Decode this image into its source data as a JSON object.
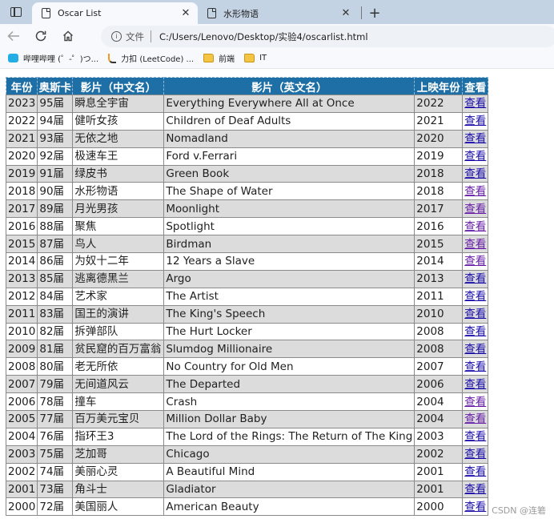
{
  "browser": {
    "tabs": [
      {
        "title": "Oscar List",
        "active": true
      },
      {
        "title": "水形物语",
        "active": false
      }
    ],
    "new_tab": "+",
    "close_glyph": "✕",
    "address": {
      "info_glyph": "i",
      "scheme_label": "文件",
      "url": "C:/Users/Lenovo/Desktop/实验4/oscarlist.html"
    },
    "bookmarks": [
      {
        "label": "哔哩哔哩 (゜-゜)つ...",
        "icon": "bilibili-icon"
      },
      {
        "label": "力扣 (LeetCode) ...",
        "icon": "leetcode-icon"
      },
      {
        "label": "前端",
        "icon": "folder-icon"
      },
      {
        "label": "IT",
        "icon": "folder-icon"
      }
    ]
  },
  "table": {
    "headers": [
      "年份",
      "奥斯卡",
      "影片（中文名）",
      "影片（英文名）",
      "上映年份",
      "查看"
    ],
    "view_label": "查看",
    "rows": [
      {
        "year": "2023",
        "session": "95届",
        "cn": "瞬息全宇宙",
        "en": "Everything Everywhere All at Once",
        "release": "2022",
        "visited": false
      },
      {
        "year": "2022",
        "session": "94届",
        "cn": "健听女孩",
        "en": "Children of Deaf Adults",
        "release": "2021",
        "visited": false
      },
      {
        "year": "2021",
        "session": "93届",
        "cn": "无依之地",
        "en": "Nomadland",
        "release": "2020",
        "visited": false
      },
      {
        "year": "2020",
        "session": "92届",
        "cn": "极速车王",
        "en": "Ford v.Ferrari",
        "release": "2019",
        "visited": false
      },
      {
        "year": "2019",
        "session": "91届",
        "cn": "绿皮书",
        "en": "Green Book",
        "release": "2018",
        "visited": false
      },
      {
        "year": "2018",
        "session": "90届",
        "cn": "水形物语",
        "en": "The Shape of Water",
        "release": "2018",
        "visited": true
      },
      {
        "year": "2017",
        "session": "89届",
        "cn": "月光男孩",
        "en": "Moonlight",
        "release": "2017",
        "visited": true
      },
      {
        "year": "2016",
        "session": "88届",
        "cn": "聚焦",
        "en": "Spotlight",
        "release": "2016",
        "visited": true
      },
      {
        "year": "2015",
        "session": "87届",
        "cn": "鸟人",
        "en": "Birdman",
        "release": "2015",
        "visited": true
      },
      {
        "year": "2014",
        "session": "86届",
        "cn": "为奴十二年",
        "en": "12 Years a Slave",
        "release": "2014",
        "visited": true
      },
      {
        "year": "2013",
        "session": "85届",
        "cn": "逃离德黑兰",
        "en": "Argo",
        "release": "2013",
        "visited": false
      },
      {
        "year": "2012",
        "session": "84届",
        "cn": "艺术家",
        "en": "The Artist",
        "release": "2011",
        "visited": false
      },
      {
        "year": "2011",
        "session": "83届",
        "cn": "国王的演讲",
        "en": "The King's Speech",
        "release": "2010",
        "visited": false
      },
      {
        "year": "2010",
        "session": "82届",
        "cn": "拆弹部队",
        "en": "The Hurt Locker",
        "release": "2008",
        "visited": false
      },
      {
        "year": "2009",
        "session": "81届",
        "cn": "贫民窟的百万富翁",
        "en": "Slumdog Millionaire",
        "release": "2008",
        "visited": false
      },
      {
        "year": "2008",
        "session": "80届",
        "cn": "老无所依",
        "en": "No Country for Old Men",
        "release": "2007",
        "visited": false
      },
      {
        "year": "2007",
        "session": "79届",
        "cn": "无间道风云",
        "en": "The Departed",
        "release": "2006",
        "visited": false
      },
      {
        "year": "2006",
        "session": "78届",
        "cn": "撞车",
        "en": "Crash",
        "release": "2004",
        "visited": true
      },
      {
        "year": "2005",
        "session": "77届",
        "cn": "百万美元宝贝",
        "en": "Million Dollar Baby",
        "release": "2004",
        "visited": true
      },
      {
        "year": "2004",
        "session": "76届",
        "cn": "指环王3",
        "en": "The Lord of the Rings: The Return of The King",
        "release": "2003",
        "visited": false
      },
      {
        "year": "2003",
        "session": "75届",
        "cn": "芝加哥",
        "en": "Chicago",
        "release": "2002",
        "visited": false
      },
      {
        "year": "2002",
        "session": "74届",
        "cn": "美丽心灵",
        "en": "A Beautiful Mind",
        "release": "2001",
        "visited": false
      },
      {
        "year": "2001",
        "session": "73届",
        "cn": "角斗士",
        "en": "Gladiator",
        "release": "2001",
        "visited": false
      },
      {
        "year": "2000",
        "session": "72届",
        "cn": "美国丽人",
        "en": "American Beauty",
        "release": "2000",
        "visited": false
      }
    ]
  },
  "watermark": "CSDN @连箬",
  "colors": {
    "header_bg": "#1e6fa6",
    "row_odd": "#dcdcdc",
    "row_even": "#ffffff",
    "link": "#1a0dab",
    "link_visited": "#681da8"
  }
}
